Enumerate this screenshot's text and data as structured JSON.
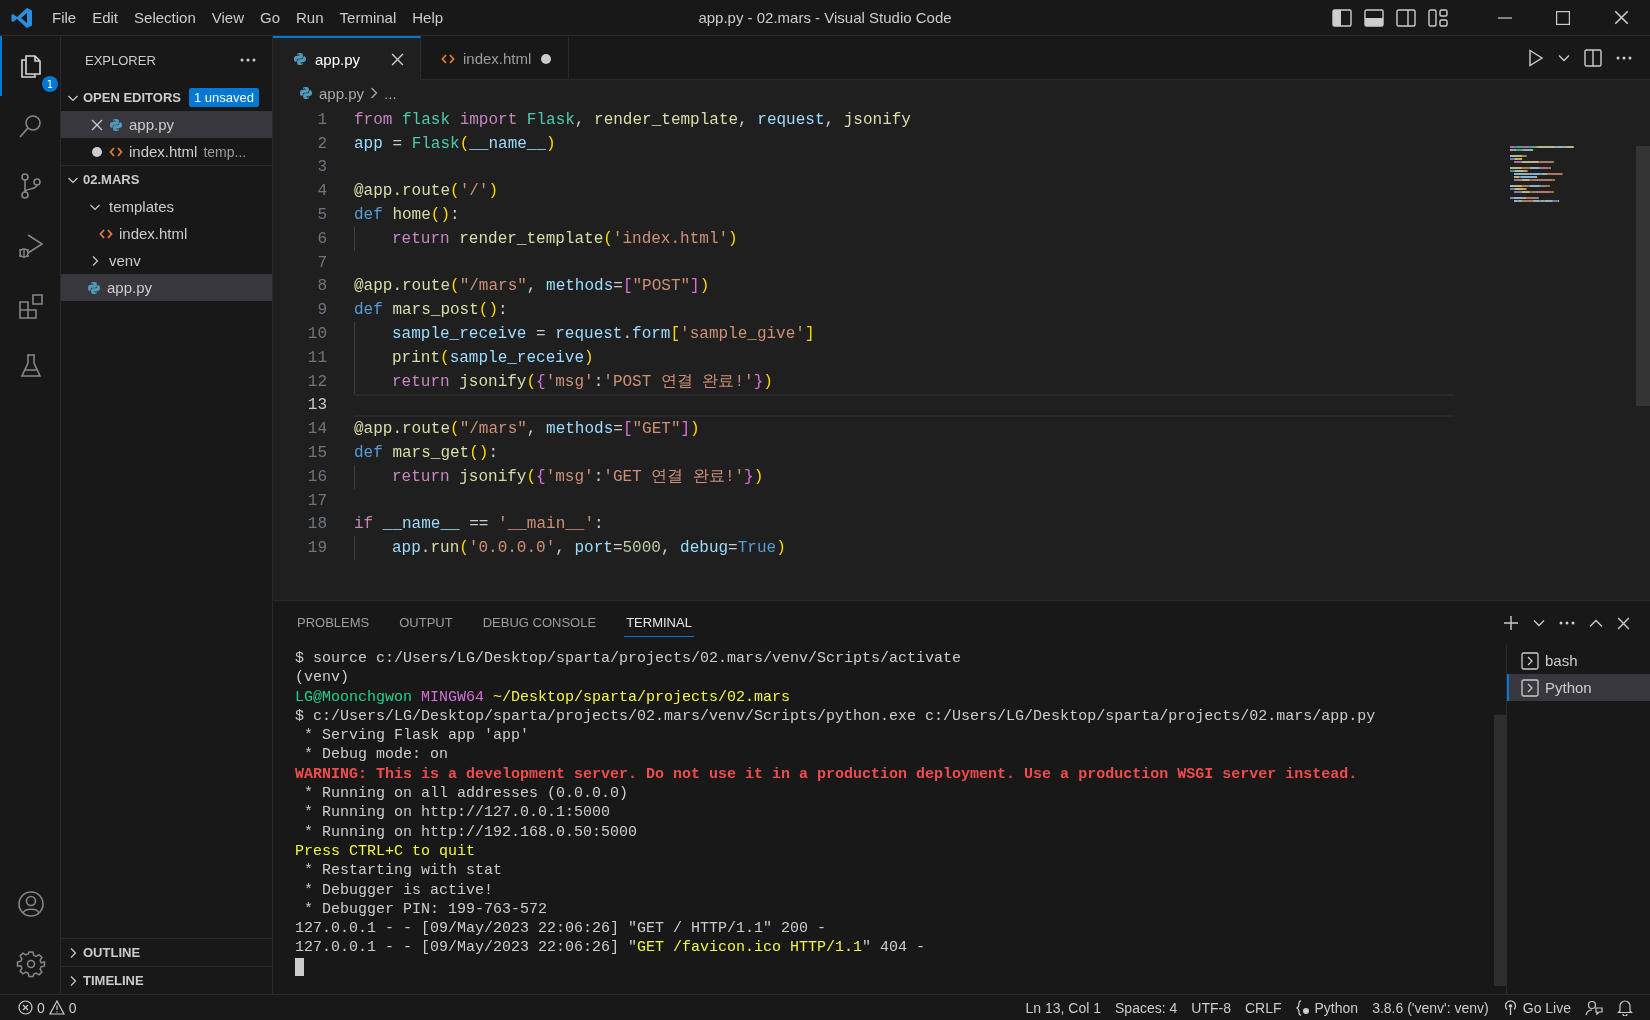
{
  "title_bar": {
    "menu": [
      "File",
      "Edit",
      "Selection",
      "View",
      "Go",
      "Run",
      "Terminal",
      "Help"
    ],
    "title": "app.py - 02.mars - Visual Studio Code"
  },
  "activity_bar": {
    "items": [
      {
        "kind": "files",
        "selected": true,
        "badge": "1"
      },
      {
        "kind": "search",
        "selected": false
      },
      {
        "kind": "source-control",
        "selected": false
      },
      {
        "kind": "run-debug",
        "selected": false
      },
      {
        "kind": "extensions",
        "selected": false
      },
      {
        "kind": "testing",
        "selected": false
      }
    ],
    "bottom": [
      {
        "kind": "account"
      },
      {
        "kind": "settings"
      }
    ]
  },
  "sidebar": {
    "title": "EXPLORER",
    "open_editors": {
      "label": "OPEN EDITORS",
      "expanded": true,
      "badge": "1 unsaved",
      "items": [
        {
          "name": "app.py",
          "kind": "python",
          "selected": true,
          "modified": false
        },
        {
          "name": "index.html",
          "kind": "html",
          "description": "temp...",
          "selected": false,
          "modified": true
        }
      ]
    },
    "folder": {
      "label": "02.MARS",
      "expanded": true,
      "tree": [
        {
          "name": "templates",
          "kind": "folder",
          "expanded": true,
          "selected": false,
          "children": [
            {
              "name": "index.html",
              "kind": "html",
              "selected": false
            }
          ]
        },
        {
          "name": "venv",
          "kind": "folder",
          "expanded": false,
          "selected": false
        },
        {
          "name": "app.py",
          "kind": "python",
          "selected": true
        }
      ]
    },
    "bottom_sections": [
      {
        "label": "OUTLINE",
        "expanded": false
      },
      {
        "label": "TIMELINE",
        "expanded": false
      }
    ]
  },
  "editor": {
    "tabs": [
      {
        "label": "app.py",
        "kind": "python",
        "selected": true,
        "modified": false
      },
      {
        "label": "index.html",
        "kind": "html",
        "selected": false,
        "modified": true
      }
    ],
    "breadcrumb": [
      {
        "text": "app.py",
        "kind": "python"
      },
      {
        "text": "..."
      }
    ],
    "lines": [
      {
        "number": "1",
        "current": false,
        "indented": false,
        "tokens": [
          {
            "text": "from ",
            "kind": "kw"
          },
          {
            "text": "flask ",
            "kind": "cls"
          },
          {
            "text": "import ",
            "kind": "kw"
          },
          {
            "text": "Flask",
            "kind": "cls"
          },
          {
            "text": ", ",
            "kind": "plain"
          },
          {
            "text": "render_template",
            "kind": "fn"
          },
          {
            "text": ", ",
            "kind": "plain"
          },
          {
            "text": "request",
            "kind": "var"
          },
          {
            "text": ", ",
            "kind": "plain"
          },
          {
            "text": "jsonify",
            "kind": "fn"
          }
        ]
      },
      {
        "number": "2",
        "current": false,
        "indented": false,
        "tokens": [
          {
            "text": "app",
            "kind": "var"
          },
          {
            "text": " = ",
            "kind": "plain"
          },
          {
            "text": "Flask",
            "kind": "cls"
          },
          {
            "text": "(",
            "kind": "br1"
          },
          {
            "text": "__name__",
            "kind": "var"
          },
          {
            "text": ")",
            "kind": "br1"
          }
        ]
      },
      {
        "number": "3",
        "current": false,
        "indented": false
      },
      {
        "number": "4",
        "current": false,
        "indented": false,
        "tokens": [
          {
            "text": "@app.route",
            "kind": "fn"
          },
          {
            "text": "(",
            "kind": "br1"
          },
          {
            "text": "'/'",
            "kind": "str"
          },
          {
            "text": ")",
            "kind": "br1"
          }
        ]
      },
      {
        "number": "5",
        "current": false,
        "indented": false,
        "tokens": [
          {
            "text": "def ",
            "kind": "def"
          },
          {
            "text": "home",
            "kind": "fn"
          },
          {
            "text": "()",
            "kind": "br1"
          },
          {
            "text": ":",
            "kind": "plain"
          }
        ]
      },
      {
        "number": "6",
        "current": false,
        "indented": true,
        "tokens": [
          {
            "text": "return ",
            "kind": "kw"
          },
          {
            "text": "render_template",
            "kind": "fn"
          },
          {
            "text": "(",
            "kind": "br1"
          },
          {
            "text": "'index.html'",
            "kind": "str"
          },
          {
            "text": ")",
            "kind": "br1"
          }
        ]
      },
      {
        "number": "7",
        "current": false,
        "indented": false
      },
      {
        "number": "8",
        "current": false,
        "indented": false,
        "tokens": [
          {
            "text": "@app.route",
            "kind": "fn"
          },
          {
            "text": "(",
            "kind": "br1"
          },
          {
            "text": "\"/mars\"",
            "kind": "str"
          },
          {
            "text": ", ",
            "kind": "plain"
          },
          {
            "text": "methods",
            "kind": "var"
          },
          {
            "text": "=",
            "kind": "plain"
          },
          {
            "text": "[",
            "kind": "br2"
          },
          {
            "text": "\"POST\"",
            "kind": "str"
          },
          {
            "text": "]",
            "kind": "br2"
          },
          {
            "text": ")",
            "kind": "br1"
          }
        ]
      },
      {
        "number": "9",
        "current": false,
        "indented": false,
        "tokens": [
          {
            "text": "def ",
            "kind": "def"
          },
          {
            "text": "mars_post",
            "kind": "fn"
          },
          {
            "text": "()",
            "kind": "br1"
          },
          {
            "text": ":",
            "kind": "plain"
          }
        ]
      },
      {
        "number": "10",
        "current": false,
        "indented": true,
        "tokens": [
          {
            "text": "sample_receive",
            "kind": "var"
          },
          {
            "text": " = ",
            "kind": "plain"
          },
          {
            "text": "request",
            "kind": "var"
          },
          {
            "text": ".",
            "kind": "plain"
          },
          {
            "text": "form",
            "kind": "var"
          },
          {
            "text": "[",
            "kind": "br1"
          },
          {
            "text": "'sample_give'",
            "kind": "str"
          },
          {
            "text": "]",
            "kind": "br1"
          }
        ]
      },
      {
        "number": "11",
        "current": false,
        "indented": true,
        "tokens": [
          {
            "text": "print",
            "kind": "fn"
          },
          {
            "text": "(",
            "kind": "br1"
          },
          {
            "text": "sample_receive",
            "kind": "var"
          },
          {
            "text": ")",
            "kind": "br1"
          }
        ]
      },
      {
        "number": "12",
        "current": false,
        "indented": true,
        "tokens": [
          {
            "text": "return ",
            "kind": "kw"
          },
          {
            "text": "jsonify",
            "kind": "fn"
          },
          {
            "text": "(",
            "kind": "br1"
          },
          {
            "text": "{",
            "kind": "br2"
          },
          {
            "text": "'msg'",
            "kind": "str"
          },
          {
            "text": ":",
            "kind": "plain"
          },
          {
            "text": "'POST 연결 완료!'",
            "kind": "str"
          },
          {
            "text": "}",
            "kind": "br2"
          },
          {
            "text": ")",
            "kind": "br1"
          }
        ]
      },
      {
        "number": "13",
        "current": true,
        "indented": false
      },
      {
        "number": "14",
        "current": false,
        "indented": false,
        "tokens": [
          {
            "text": "@app.route",
            "kind": "fn"
          },
          {
            "text": "(",
            "kind": "br1"
          },
          {
            "text": "\"/mars\"",
            "kind": "str"
          },
          {
            "text": ", ",
            "kind": "plain"
          },
          {
            "text": "methods",
            "kind": "var"
          },
          {
            "text": "=",
            "kind": "plain"
          },
          {
            "text": "[",
            "kind": "br2"
          },
          {
            "text": "\"GET\"",
            "kind": "str"
          },
          {
            "text": "]",
            "kind": "br2"
          },
          {
            "text": ")",
            "kind": "br1"
          }
        ]
      },
      {
        "number": "15",
        "current": false,
        "indented": false,
        "tokens": [
          {
            "text": "def ",
            "kind": "def"
          },
          {
            "text": "mars_get",
            "kind": "fn"
          },
          {
            "text": "()",
            "kind": "br1"
          },
          {
            "text": ":",
            "kind": "plain"
          }
        ]
      },
      {
        "number": "16",
        "current": false,
        "indented": true,
        "tokens": [
          {
            "text": "return ",
            "kind": "kw"
          },
          {
            "text": "jsonify",
            "kind": "fn"
          },
          {
            "text": "(",
            "kind": "br1"
          },
          {
            "text": "{",
            "kind": "br2"
          },
          {
            "text": "'msg'",
            "kind": "str"
          },
          {
            "text": ":",
            "kind": "plain"
          },
          {
            "text": "'GET 연결 완료!'",
            "kind": "str"
          },
          {
            "text": "}",
            "kind": "br2"
          },
          {
            "text": ")",
            "kind": "br1"
          }
        ]
      },
      {
        "number": "17",
        "current": false,
        "indented": false
      },
      {
        "number": "18",
        "current": false,
        "indented": false,
        "tokens": [
          {
            "text": "if ",
            "kind": "kw"
          },
          {
            "text": "__name__",
            "kind": "var"
          },
          {
            "text": " == ",
            "kind": "plain"
          },
          {
            "text": "'__main__'",
            "kind": "str"
          },
          {
            "text": ":",
            "kind": "plain"
          }
        ]
      },
      {
        "number": "19",
        "current": false,
        "indented": true,
        "tokens": [
          {
            "text": "app",
            "kind": "var"
          },
          {
            "text": ".",
            "kind": "plain"
          },
          {
            "text": "run",
            "kind": "fn"
          },
          {
            "text": "(",
            "kind": "br1"
          },
          {
            "text": "'0.0.0.0'",
            "kind": "str"
          },
          {
            "text": ", ",
            "kind": "plain"
          },
          {
            "text": "port",
            "kind": "var"
          },
          {
            "text": "=",
            "kind": "plain"
          },
          {
            "text": "5000",
            "kind": "num"
          },
          {
            "text": ", ",
            "kind": "plain"
          },
          {
            "text": "debug",
            "kind": "var"
          },
          {
            "text": "=",
            "kind": "plain"
          },
          {
            "text": "True",
            "kind": "def"
          },
          {
            "text": ")",
            "kind": "br1"
          }
        ]
      }
    ]
  },
  "panel": {
    "tabs": [
      {
        "label": "PROBLEMS",
        "selected": false
      },
      {
        "label": "OUTPUT",
        "selected": false
      },
      {
        "label": "DEBUG CONSOLE",
        "selected": false
      },
      {
        "label": "TERMINAL",
        "selected": true
      }
    ],
    "terminal": {
      "cursor": true,
      "lines": [
        [
          {
            "text": "$ source c:/Users/LG/Desktop/sparta/projects/02.mars/venv/Scripts/activate",
            "kind": "plain"
          }
        ],
        [
          {
            "text": "(venv)",
            "kind": "plain"
          }
        ],
        [
          {
            "text": "LG@Moonchgwon ",
            "kind": "green"
          },
          {
            "text": "MINGW64 ",
            "kind": "magenta"
          },
          {
            "text": "~/Desktop/sparta/projects/02.mars",
            "kind": "yellow"
          }
        ],
        [
          {
            "text": "$ c:/Users/LG/Desktop/sparta/projects/02.mars/venv/Scripts/python.exe c:/Users/LG/Desktop/sparta/projects/02.mars/app.py",
            "kind": "plain"
          }
        ],
        [
          {
            "text": " * Serving Flask app 'app'",
            "kind": "plain"
          }
        ],
        [
          {
            "text": " * Debug mode: on",
            "kind": "plain"
          }
        ],
        [
          {
            "text": "WARNING: This is a development server. Do not use it in a production deployment. Use a production WSGI server instead.",
            "kind": "red"
          }
        ],
        [
          {
            "text": " * Running on all addresses (0.0.0.0)",
            "kind": "plain"
          }
        ],
        [
          {
            "text": " * Running on http://127.0.0.1:5000",
            "kind": "plain"
          }
        ],
        [
          {
            "text": " * Running on http://192.168.0.50:5000",
            "kind": "plain"
          }
        ],
        [
          {
            "text": "Press CTRL+C to quit",
            "kind": "yellow"
          }
        ],
        [
          {
            "text": " * Restarting with stat",
            "kind": "plain"
          }
        ],
        [
          {
            "text": " * Debugger is active!",
            "kind": "plain"
          }
        ],
        [
          {
            "text": " * Debugger PIN: 199-763-572",
            "kind": "plain"
          }
        ],
        [
          {
            "text": "127.0.0.1 - - [09/May/2023 22:06:26] \"GET / HTTP/1.1\" 200 -",
            "kind": "plain"
          }
        ],
        [
          {
            "text": "127.0.0.1 - - [09/May/2023 22:06:26] \"",
            "kind": "plain"
          },
          {
            "text": "GET /favicon.ico HTTP/1.1",
            "kind": "yellow"
          },
          {
            "text": "\" 404 -",
            "kind": "plain"
          }
        ]
      ]
    },
    "terminals": [
      {
        "label": "bash",
        "selected": false
      },
      {
        "label": "Python",
        "selected": true
      }
    ]
  },
  "status_bar": {
    "errors": "0",
    "warnings": "0",
    "items": [
      {
        "text": "Ln 13, Col 1",
        "kind": "text"
      },
      {
        "text": "Spaces: 4",
        "kind": "text"
      },
      {
        "text": "UTF-8",
        "kind": "text"
      },
      {
        "text": "CRLF",
        "kind": "text"
      },
      {
        "text": "Python",
        "kind": "language"
      },
      {
        "text": "3.8.6 ('venv': venv)",
        "kind": "text"
      },
      {
        "text": "Go Live",
        "kind": "live"
      },
      {
        "kind": "feedback"
      },
      {
        "kind": "bell"
      }
    ]
  }
}
